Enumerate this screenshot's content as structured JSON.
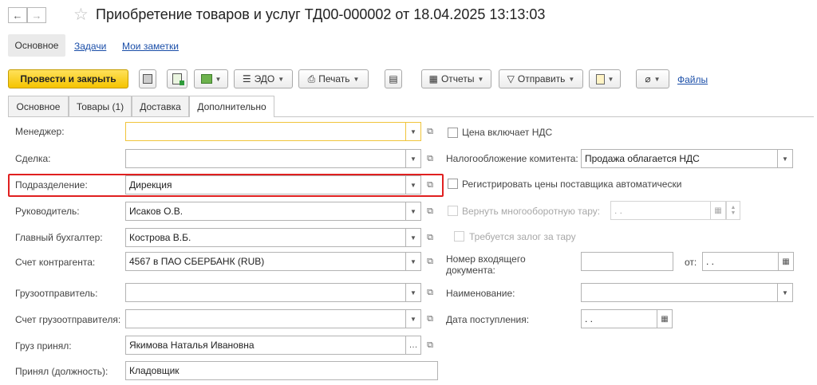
{
  "header": {
    "title": "Приобретение товаров и услуг ТД00-000002 от 18.04.2025 13:13:03",
    "back_glyph": "←",
    "forward_glyph": "→"
  },
  "sections": {
    "main": "Основное",
    "tasks": "Задачи",
    "notes": "Мои заметки"
  },
  "toolbar": {
    "post_close": "Провести и закрыть",
    "edo": "ЭДО",
    "print": "Печать",
    "reports": "Отчеты",
    "send": "Отправить",
    "files": "Файлы"
  },
  "tabs": [
    {
      "label": "Основное"
    },
    {
      "label": "Товары (1)"
    },
    {
      "label": "Доставка"
    },
    {
      "label": "Дополнительно"
    }
  ],
  "left_fields": {
    "manager": {
      "label": "Менеджер:",
      "value": ""
    },
    "deal": {
      "label": "Сделка:",
      "value": ""
    },
    "division": {
      "label": "Подразделение:",
      "value": "Дирекция"
    },
    "head": {
      "label": "Руководитель:",
      "value": "Исаков О.В."
    },
    "accountant": {
      "label": "Главный бухгалтер:",
      "value": "Кострова В.Б."
    },
    "account": {
      "label": "Счет контрагента:",
      "value": "4567 в ПАО СБЕРБАНК (RUB)"
    },
    "shipper": {
      "label": "Грузоотправитель:",
      "value": ""
    },
    "shipper_account": {
      "label": "Счет грузоотправителя:",
      "value": ""
    },
    "received_by": {
      "label": "Груз принял:",
      "value": "Якимова Наталья Ивановна"
    },
    "position": {
      "label": "Принял (должность):",
      "value": "Кладовщик"
    }
  },
  "right_fields": {
    "price_vat": {
      "label": "Цена включает НДС"
    },
    "taxation": {
      "label": "Налогообложение комитента:",
      "value": "Продажа облагается НДС"
    },
    "register_prices": {
      "label": "Регистрировать цены поставщика автоматически"
    },
    "return_tare": {
      "label": "Вернуть многооборотную тару:",
      "value": " .  ."
    },
    "deposit": {
      "label": "Требуется залог за тару"
    },
    "incoming_number": {
      "label": "Номер входящего документа:",
      "value": ""
    },
    "from": {
      "label": "от:",
      "value": " .  ."
    },
    "name": {
      "label": "Наименование:",
      "value": ""
    },
    "arrival_date": {
      "label": "Дата поступления:",
      "value": " .  ."
    }
  },
  "colors": {
    "primary": "#f5c400",
    "link": "#1a4ea8",
    "highlight": "#e02020"
  }
}
